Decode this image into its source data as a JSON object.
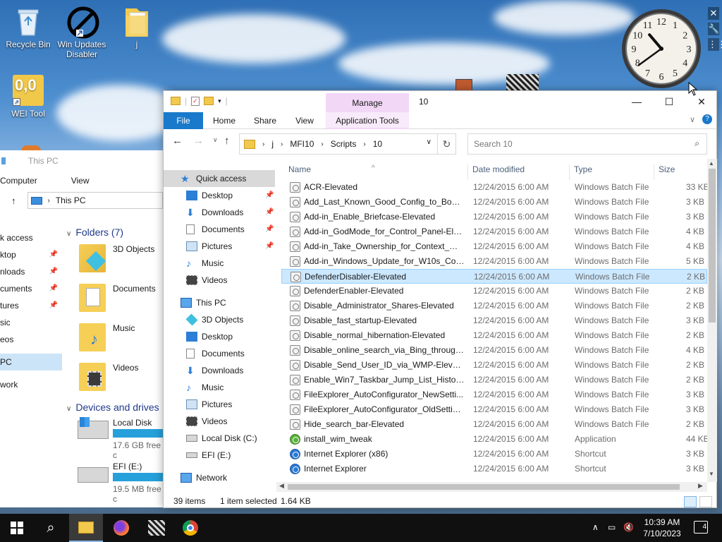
{
  "desktop": {
    "icons": [
      {
        "label": "Recycle Bin"
      },
      {
        "label": "Win Updates Disabler"
      },
      {
        "label": "j"
      },
      {
        "label": "WEI Tool",
        "glyph": "0,0"
      }
    ]
  },
  "clock_gadget": {
    "numerals": [
      "12",
      "1",
      "2",
      "3",
      "4",
      "5",
      "6",
      "7",
      "8",
      "9",
      "10",
      "11"
    ],
    "hour": 10,
    "minute": 39
  },
  "background_window": {
    "title": "This PC",
    "menu": [
      "Computer",
      "View"
    ],
    "address": "This PC",
    "nav_items": [
      {
        "label": "k access",
        "pinned": false
      },
      {
        "label": "ktop",
        "pinned": true
      },
      {
        "label": "nloads",
        "pinned": true
      },
      {
        "label": "cuments",
        "pinned": true
      },
      {
        "label": "tures",
        "pinned": true
      },
      {
        "label": "sic",
        "pinned": false
      },
      {
        "label": "eos",
        "pinned": false
      },
      {
        "label": "PC",
        "pinned": false,
        "selected": true
      },
      {
        "label": "work",
        "pinned": false
      }
    ],
    "folders_header": "Folders (7)",
    "folders": [
      "3D Objects",
      "Documents",
      "Music",
      "Videos"
    ],
    "devices_header": "Devices and drives",
    "drives": [
      {
        "name": "Local Disk (C:",
        "free": "17.6 GB free c"
      },
      {
        "name": "EFI (E:)",
        "free": "19.5 MB free c"
      }
    ]
  },
  "window": {
    "title": "10",
    "context_tab": "Manage",
    "ribbon_tabs": [
      "File",
      "Home",
      "Share",
      "View",
      "Application Tools"
    ],
    "address_segments": [
      "j",
      "MFI10",
      "Scripts",
      "10"
    ],
    "search_placeholder": "Search 10",
    "nav": {
      "quick_access": "Quick access",
      "quick_items": [
        "Desktop",
        "Downloads",
        "Documents",
        "Pictures",
        "Music",
        "Videos"
      ],
      "this_pc": "This PC",
      "pc_items": [
        "3D Objects",
        "Desktop",
        "Documents",
        "Downloads",
        "Music",
        "Pictures",
        "Videos",
        "Local Disk (C:)",
        "EFI (E:)"
      ],
      "network": "Network"
    },
    "columns": [
      "Name",
      "Date modified",
      "Type",
      "Size"
    ],
    "files": [
      {
        "name": "ACR-Elevated",
        "date": "12/24/2015 6:00 AM",
        "type": "Windows Batch File",
        "size": "33 KB",
        "icon": "batch"
      },
      {
        "name": "Add_Last_Known_Good_Config_to_Boot_...",
        "date": "12/24/2015 6:00 AM",
        "type": "Windows Batch File",
        "size": "3 KB",
        "icon": "batch"
      },
      {
        "name": "Add-in_Enable_Briefcase-Elevated",
        "date": "12/24/2015 6:00 AM",
        "type": "Windows Batch File",
        "size": "3 KB",
        "icon": "batch"
      },
      {
        "name": "Add-in_GodMode_for_Control_Panel-Ele...",
        "date": "12/24/2015 6:00 AM",
        "type": "Windows Batch File",
        "size": "4 KB",
        "icon": "batch"
      },
      {
        "name": "Add-in_Take_Ownership_for_Context_Me...",
        "date": "12/24/2015 6:00 AM",
        "type": "Windows Batch File",
        "size": "4 KB",
        "icon": "batch"
      },
      {
        "name": "Add-in_Windows_Update_for_W10s_Con...",
        "date": "12/24/2015 6:00 AM",
        "type": "Windows Batch File",
        "size": "5 KB",
        "icon": "batch"
      },
      {
        "name": "DefenderDisabler-Elevated",
        "date": "12/24/2015 6:00 AM",
        "type": "Windows Batch File",
        "size": "2 KB",
        "icon": "batch",
        "selected": true
      },
      {
        "name": "DefenderEnabler-Elevated",
        "date": "12/24/2015 6:00 AM",
        "type": "Windows Batch File",
        "size": "2 KB",
        "icon": "batch"
      },
      {
        "name": "Disable_Administrator_Shares-Elevated",
        "date": "12/24/2015 6:00 AM",
        "type": "Windows Batch File",
        "size": "2 KB",
        "icon": "batch"
      },
      {
        "name": "Disable_fast_startup-Elevated",
        "date": "12/24/2015 6:00 AM",
        "type": "Windows Batch File",
        "size": "3 KB",
        "icon": "batch"
      },
      {
        "name": "Disable_normal_hibernation-Elevated",
        "date": "12/24/2015 6:00 AM",
        "type": "Windows Batch File",
        "size": "2 KB",
        "icon": "batch"
      },
      {
        "name": "Disable_online_search_via_Bing_through_...",
        "date": "12/24/2015 6:00 AM",
        "type": "Windows Batch File",
        "size": "4 KB",
        "icon": "batch"
      },
      {
        "name": "Disable_Send_User_ID_via_WMP-Elevated",
        "date": "12/24/2015 6:00 AM",
        "type": "Windows Batch File",
        "size": "2 KB",
        "icon": "batch"
      },
      {
        "name": "Enable_Win7_Taskbar_Jump_List_History-...",
        "date": "12/24/2015 6:00 AM",
        "type": "Windows Batch File",
        "size": "2 KB",
        "icon": "batch"
      },
      {
        "name": "FileExplorer_AutoConfigurator_NewSetti...",
        "date": "12/24/2015 6:00 AM",
        "type": "Windows Batch File",
        "size": "3 KB",
        "icon": "batch"
      },
      {
        "name": "FileExplorer_AutoConfigurator_OldSettings",
        "date": "12/24/2015 6:00 AM",
        "type": "Windows Batch File",
        "size": "3 KB",
        "icon": "batch"
      },
      {
        "name": "Hide_search_bar-Elevated",
        "date": "12/24/2015 6:00 AM",
        "type": "Windows Batch File",
        "size": "2 KB",
        "icon": "batch"
      },
      {
        "name": "install_wim_tweak",
        "date": "12/24/2015 6:00 AM",
        "type": "Application",
        "size": "44 KB",
        "icon": "app"
      },
      {
        "name": "Internet Explorer (x86)",
        "date": "12/24/2015 6:00 AM",
        "type": "Shortcut",
        "size": "3 KB",
        "icon": "ie"
      },
      {
        "name": "Internet Explorer",
        "date": "12/24/2015 6:00 AM",
        "type": "Shortcut",
        "size": "3 KB",
        "icon": "ie"
      }
    ],
    "status": {
      "item_count": "39 items",
      "selection": "1 item selected",
      "selection_size": "1.64 KB"
    }
  },
  "taskbar": {
    "time": "10:39 AM",
    "date": "7/10/2023",
    "notifications": "4"
  },
  "colors": {
    "accent": "#1979ca",
    "context_tab": "#f2d7f7",
    "selection": "#cce8ff",
    "folder": "#f5c342"
  }
}
